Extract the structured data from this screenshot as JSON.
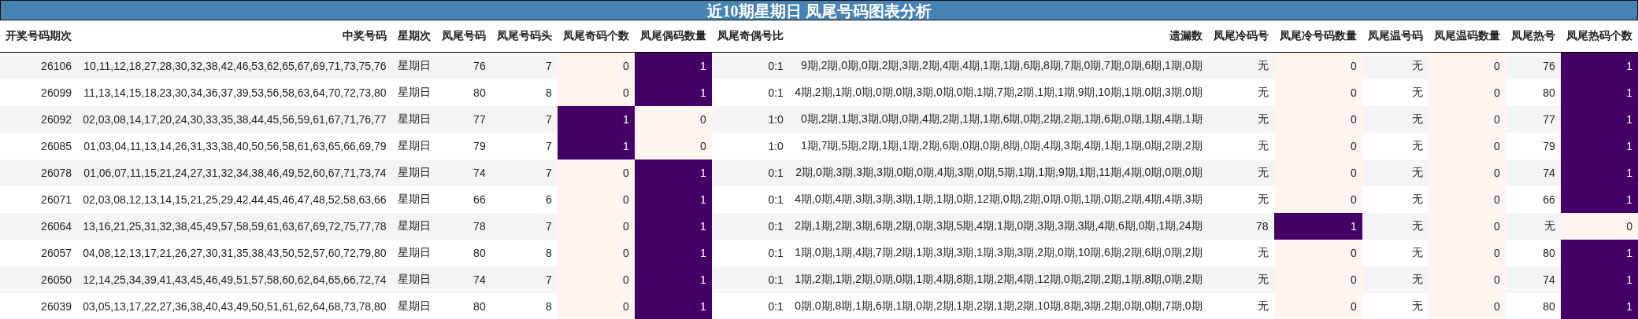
{
  "title": "近10期星期日 凤尾号码图表分析",
  "table": {
    "columns": [
      "开奖号码期次",
      "中奖号码",
      "星期次",
      "凤尾号码",
      "凤尾号码头",
      "凤尾奇码个数",
      "凤尾偶码数量",
      "凤尾奇偶号比",
      "遗漏数",
      "凤尾冷码号",
      "凤尾冷号码数量",
      "凤尾温号码",
      "凤尾温码数量",
      "凤尾热号",
      "凤尾热码个数"
    ],
    "rows": [
      {
        "cells": [
          {
            "text": "26106"
          },
          {
            "text": "10,11,12,18,27,28,30,32,38,42,46,53,62,65,67,69,71,73,75,76"
          },
          {
            "text": "星期日"
          },
          {
            "text": "76"
          },
          {
            "text": "7"
          },
          {
            "text": "0",
            "color": "#fff5f0"
          },
          {
            "text": "1",
            "color": "#440064"
          },
          {
            "text": "0:1"
          },
          {
            "text": "9期,2期,0期,0期,2期,3期,2期,4期,4期,1期,1期,6期,8期,7期,0期,7期,0期,6期,1期,0期"
          },
          {
            "text": "无"
          },
          {
            "text": "0",
            "color": "#fff5f0"
          },
          {
            "text": "无"
          },
          {
            "text": "0",
            "color": "#fff5f0"
          },
          {
            "text": "76"
          },
          {
            "text": "1",
            "color": "#440064"
          }
        ]
      },
      {
        "cells": [
          {
            "text": "26099"
          },
          {
            "text": "11,13,14,15,18,23,30,34,36,37,39,53,56,58,63,64,70,72,73,80"
          },
          {
            "text": "星期日"
          },
          {
            "text": "80"
          },
          {
            "text": "8"
          },
          {
            "text": "0",
            "color": "#fff5f0"
          },
          {
            "text": "1",
            "color": "#440064"
          },
          {
            "text": "0:1"
          },
          {
            "text": "4期,2期,1期,0期,0期,0期,3期,0期,0期,1期,7期,2期,1期,1期,9期,10期,1期,0期,3期,0期"
          },
          {
            "text": "无"
          },
          {
            "text": "0",
            "color": "#fff5f0"
          },
          {
            "text": "无"
          },
          {
            "text": "0",
            "color": "#fff5f0"
          },
          {
            "text": "80"
          },
          {
            "text": "1",
            "color": "#440064"
          }
        ]
      },
      {
        "cells": [
          {
            "text": "26092"
          },
          {
            "text": "02,03,08,14,17,20,24,30,33,35,38,44,45,56,59,61,67,71,76,77"
          },
          {
            "text": "星期日"
          },
          {
            "text": "77"
          },
          {
            "text": "7"
          },
          {
            "text": "1",
            "color": "#440064"
          },
          {
            "text": "0",
            "color": "#fff5f0"
          },
          {
            "text": "1:0"
          },
          {
            "text": "0期,2期,1期,3期,0期,0期,4期,2期,1期,1期,6期,0期,2期,2期,1期,6期,0期,1期,4期,1期"
          },
          {
            "text": "无"
          },
          {
            "text": "0",
            "color": "#fff5f0"
          },
          {
            "text": "无"
          },
          {
            "text": "0",
            "color": "#fff5f0"
          },
          {
            "text": "77"
          },
          {
            "text": "1",
            "color": "#440064"
          }
        ]
      },
      {
        "cells": [
          {
            "text": "26085"
          },
          {
            "text": "01,03,04,11,13,14,26,31,33,38,40,50,56,58,61,63,65,66,69,79"
          },
          {
            "text": "星期日"
          },
          {
            "text": "79"
          },
          {
            "text": "7"
          },
          {
            "text": "1",
            "color": "#440064"
          },
          {
            "text": "0",
            "color": "#fff5f0"
          },
          {
            "text": "1:0"
          },
          {
            "text": "1期,7期,5期,2期,1期,1期,2期,6期,0期,0期,8期,0期,4期,3期,4期,1期,1期,0期,2期,2期"
          },
          {
            "text": "无"
          },
          {
            "text": "0",
            "color": "#fff5f0"
          },
          {
            "text": "无"
          },
          {
            "text": "0",
            "color": "#fff5f0"
          },
          {
            "text": "79"
          },
          {
            "text": "1",
            "color": "#440064"
          }
        ]
      },
      {
        "cells": [
          {
            "text": "26078"
          },
          {
            "text": "01,06,07,11,15,21,24,27,31,32,34,38,46,49,52,60,67,71,73,74"
          },
          {
            "text": "星期日"
          },
          {
            "text": "74"
          },
          {
            "text": "7"
          },
          {
            "text": "0",
            "color": "#fff5f0"
          },
          {
            "text": "1",
            "color": "#440064"
          },
          {
            "text": "0:1"
          },
          {
            "text": "2期,0期,3期,3期,3期,0期,0期,4期,3期,0期,5期,1期,1期,9期,1期,11期,4期,0期,0期,0期"
          },
          {
            "text": "无"
          },
          {
            "text": "0",
            "color": "#fff5f0"
          },
          {
            "text": "无"
          },
          {
            "text": "0",
            "color": "#fff5f0"
          },
          {
            "text": "74"
          },
          {
            "text": "1",
            "color": "#440064"
          }
        ]
      },
      {
        "cells": [
          {
            "text": "26071"
          },
          {
            "text": "02,03,08,12,13,14,15,21,25,29,42,44,45,46,47,48,52,58,63,66"
          },
          {
            "text": "星期日"
          },
          {
            "text": "66"
          },
          {
            "text": "6"
          },
          {
            "text": "0",
            "color": "#fff5f0"
          },
          {
            "text": "1",
            "color": "#440064"
          },
          {
            "text": "0:1"
          },
          {
            "text": "4期,0期,4期,3期,3期,3期,1期,1期,0期,12期,0期,2期,0期,0期,1期,0期,2期,4期,4期,3期"
          },
          {
            "text": "无"
          },
          {
            "text": "0",
            "color": "#fff5f0"
          },
          {
            "text": "无"
          },
          {
            "text": "0",
            "color": "#fff5f0"
          },
          {
            "text": "66"
          },
          {
            "text": "1",
            "color": "#440064"
          }
        ]
      },
      {
        "cells": [
          {
            "text": "26064"
          },
          {
            "text": "13,16,21,25,31,32,38,45,49,57,58,59,61,63,67,69,72,75,77,78"
          },
          {
            "text": "星期日"
          },
          {
            "text": "78"
          },
          {
            "text": "7"
          },
          {
            "text": "0",
            "color": "#fff5f0"
          },
          {
            "text": "1",
            "color": "#440064"
          },
          {
            "text": "0:1"
          },
          {
            "text": "2期,1期,2期,3期,6期,2期,0期,3期,5期,4期,1期,0期,3期,3期,3期,4期,6期,0期,1期,24期"
          },
          {
            "text": "78"
          },
          {
            "text": "1",
            "color": "#440064"
          },
          {
            "text": "无"
          },
          {
            "text": "0",
            "color": "#fff5f0"
          },
          {
            "text": "无"
          },
          {
            "text": "0",
            "color": "#fff5f0"
          }
        ]
      },
      {
        "cells": [
          {
            "text": "26057"
          },
          {
            "text": "04,08,12,13,17,21,26,27,30,31,35,38,43,50,52,57,60,72,79,80"
          },
          {
            "text": "星期日"
          },
          {
            "text": "80"
          },
          {
            "text": "8"
          },
          {
            "text": "0",
            "color": "#fff5f0"
          },
          {
            "text": "1",
            "color": "#440064"
          },
          {
            "text": "0:1"
          },
          {
            "text": "1期,0期,1期,4期,7期,2期,1期,3期,3期,1期,3期,3期,2期,0期,10期,6期,2期,6期,0期,2期"
          },
          {
            "text": "无"
          },
          {
            "text": "0",
            "color": "#fff5f0"
          },
          {
            "text": "无"
          },
          {
            "text": "0",
            "color": "#fff5f0"
          },
          {
            "text": "80"
          },
          {
            "text": "1",
            "color": "#440064"
          }
        ]
      },
      {
        "cells": [
          {
            "text": "26050"
          },
          {
            "text": "12,14,25,34,39,41,43,45,46,49,51,57,58,60,62,64,65,66,72,74"
          },
          {
            "text": "星期日"
          },
          {
            "text": "74"
          },
          {
            "text": "7"
          },
          {
            "text": "0",
            "color": "#fff5f0"
          },
          {
            "text": "1",
            "color": "#440064"
          },
          {
            "text": "0:1"
          },
          {
            "text": "1期,2期,1期,2期,0期,0期,1期,4期,8期,1期,2期,4期,12期,0期,2期,2期,1期,8期,0期,2期"
          },
          {
            "text": "无"
          },
          {
            "text": "0",
            "color": "#fff5f0"
          },
          {
            "text": "无"
          },
          {
            "text": "0",
            "color": "#fff5f0"
          },
          {
            "text": "74"
          },
          {
            "text": "1",
            "color": "#440064"
          }
        ]
      },
      {
        "cells": [
          {
            "text": "26039"
          },
          {
            "text": "03,05,13,17,22,27,36,38,40,43,49,50,51,61,62,64,68,73,78,80"
          },
          {
            "text": "星期日"
          },
          {
            "text": "80"
          },
          {
            "text": "8"
          },
          {
            "text": "0",
            "color": "#fff5f0"
          },
          {
            "text": "1",
            "color": "#440064"
          },
          {
            "text": "0:1"
          },
          {
            "text": "0期,0期,8期,1期,6期,1期,0期,2期,1期,2期,1期,2期,10期,8期,3期,2期,0期,0期,7期,0期"
          },
          {
            "text": "无"
          },
          {
            "text": "0",
            "color": "#fff5f0"
          },
          {
            "text": "无"
          },
          {
            "text": "0",
            "color": "#fff5f0"
          },
          {
            "text": "80"
          },
          {
            "text": "1",
            "color": "#440064"
          }
        ]
      }
    ]
  }
}
